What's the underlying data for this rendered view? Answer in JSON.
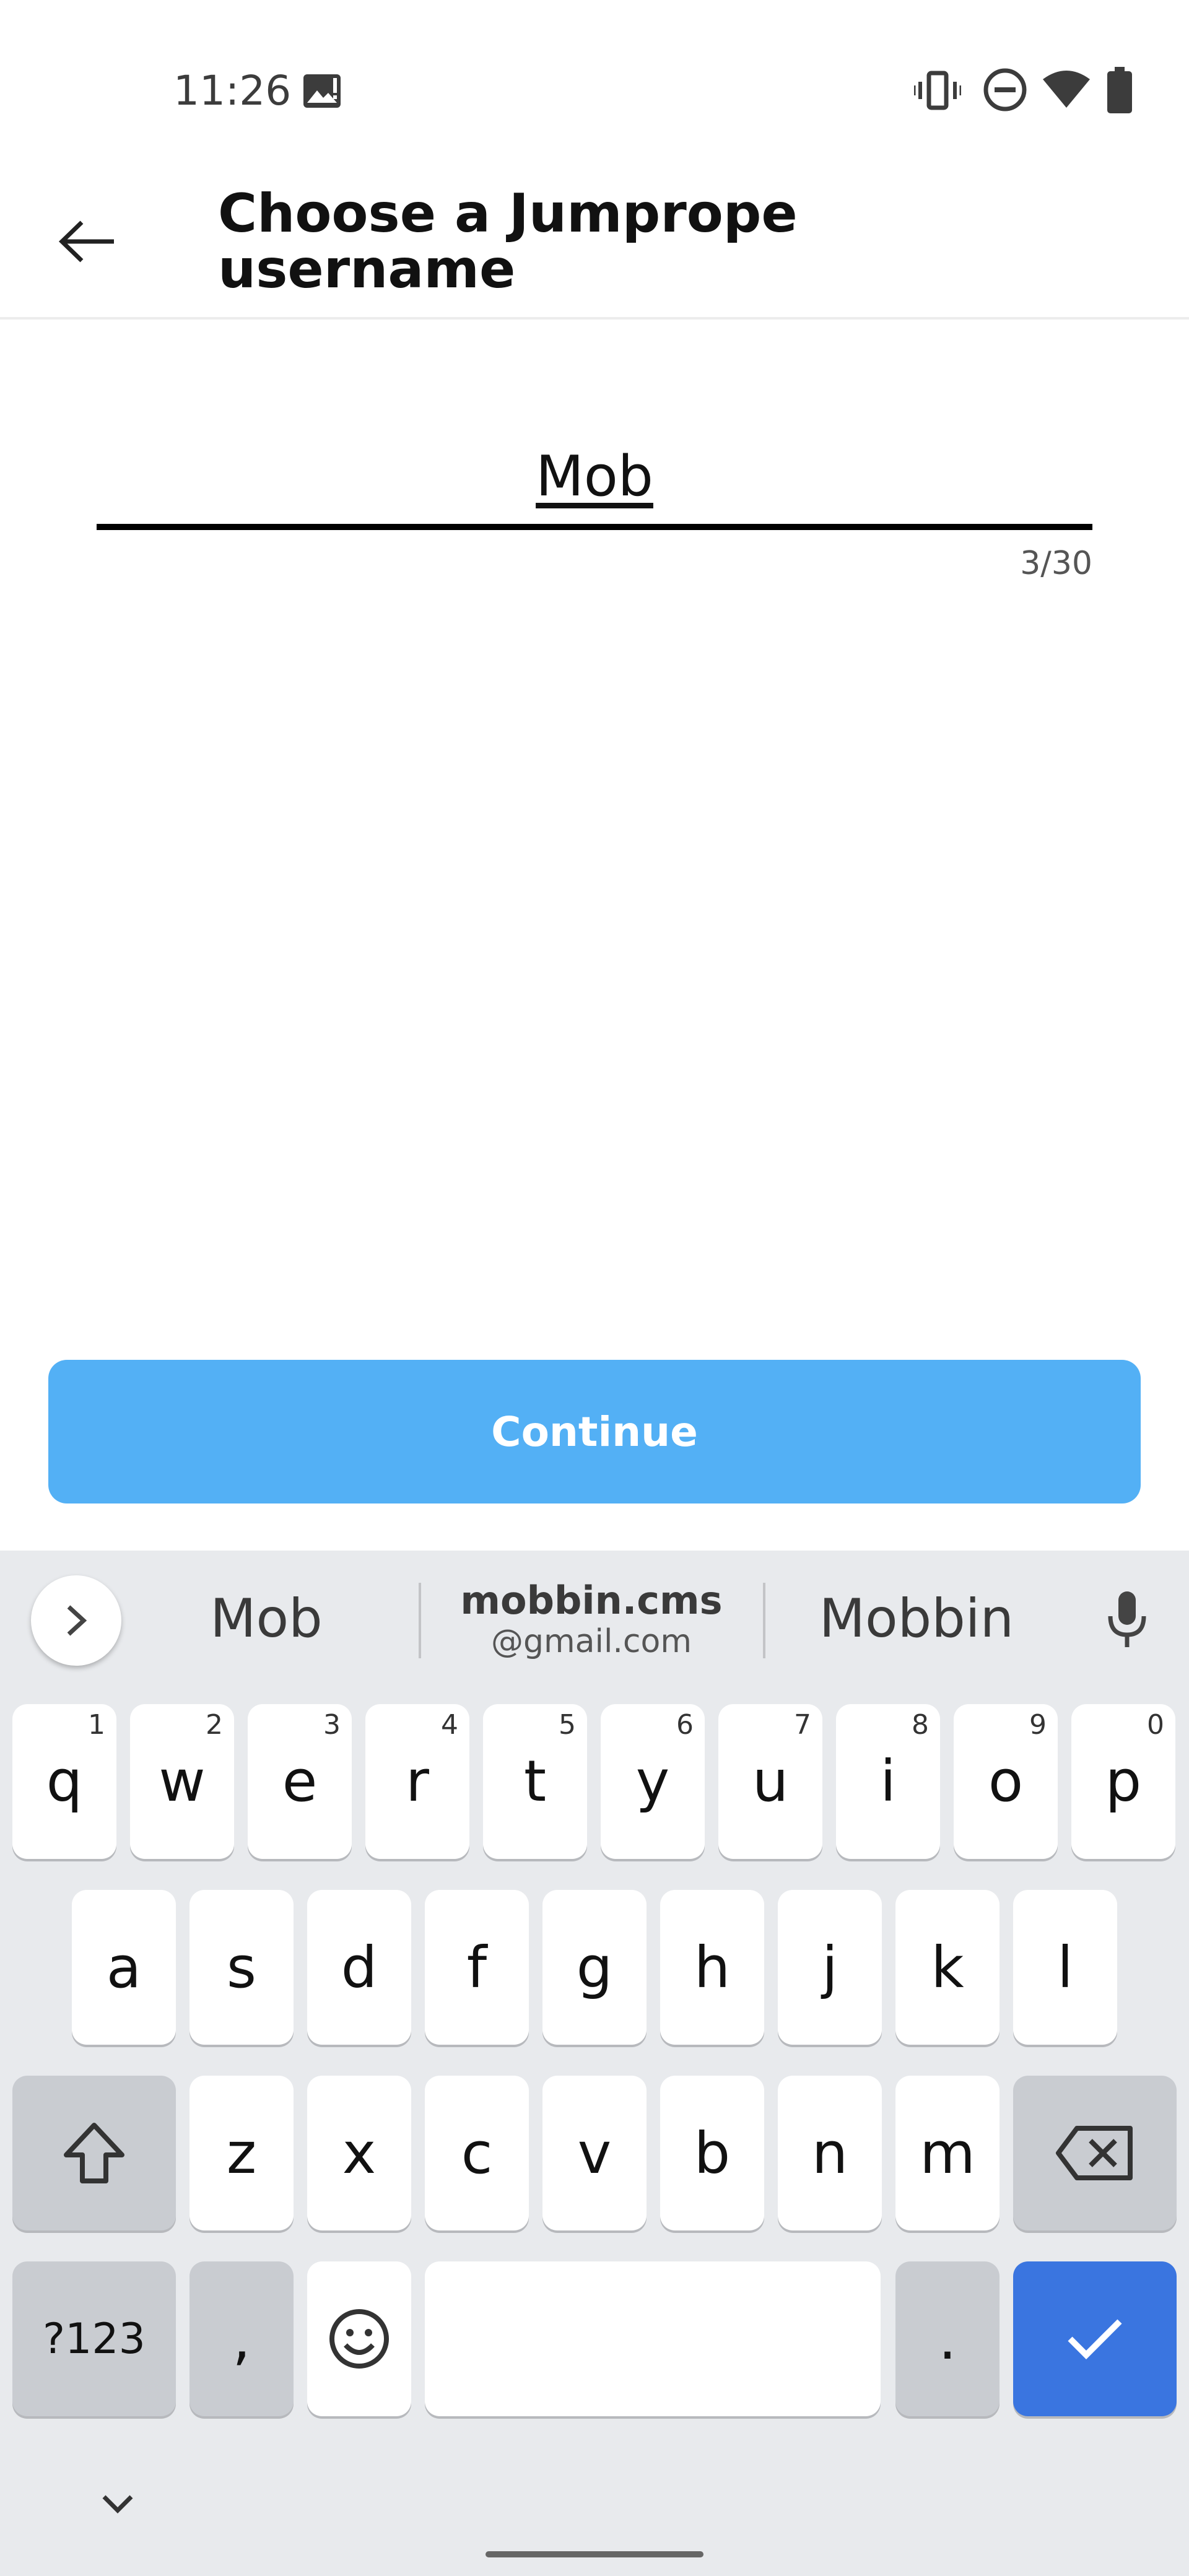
{
  "status_bar": {
    "time": "11:26",
    "icons": [
      "gallery-icon",
      "vibrate-icon",
      "do-not-disturb-icon",
      "wifi-icon",
      "battery-icon"
    ]
  },
  "app_bar": {
    "back_icon": "arrow-left-icon",
    "title": "Choose a Jumprope username"
  },
  "username_field": {
    "value": "Mob",
    "counter": "3/30"
  },
  "continue_button": {
    "label": "Continue",
    "color": "#53b0f5"
  },
  "keyboard": {
    "suggestions": {
      "expand_icon": "chevron-right-icon",
      "left": "Mob",
      "center_line1": "mobbin.cms",
      "center_line2": "@gmail.com",
      "right": "Mobbin",
      "mic_icon": "microphone-icon"
    },
    "row1": [
      {
        "key": "q",
        "hint": "1"
      },
      {
        "key": "w",
        "hint": "2"
      },
      {
        "key": "e",
        "hint": "3"
      },
      {
        "key": "r",
        "hint": "4"
      },
      {
        "key": "t",
        "hint": "5"
      },
      {
        "key": "y",
        "hint": "6"
      },
      {
        "key": "u",
        "hint": "7"
      },
      {
        "key": "i",
        "hint": "8"
      },
      {
        "key": "o",
        "hint": "9"
      },
      {
        "key": "p",
        "hint": "0"
      }
    ],
    "row2": [
      "a",
      "s",
      "d",
      "f",
      "g",
      "h",
      "j",
      "k",
      "l"
    ],
    "row3": [
      "z",
      "x",
      "c",
      "v",
      "b",
      "n",
      "m"
    ],
    "row4": {
      "symbols": "?123",
      "comma": ",",
      "period": "."
    },
    "accent_color": "#3a75e0",
    "icons": {
      "shift": "shift-icon",
      "backspace": "backspace-icon",
      "emoji": "emoji-icon",
      "enter": "checkmark-icon",
      "hide": "chevron-down-icon"
    }
  }
}
